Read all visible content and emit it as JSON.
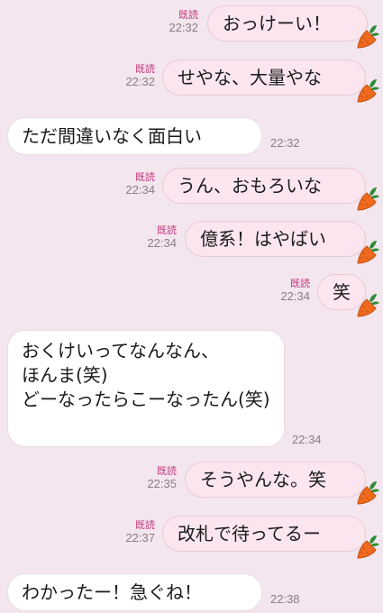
{
  "messages": [
    {
      "dir": "out",
      "text": "おっけーい！",
      "read": "既読",
      "time": "22:32"
    },
    {
      "dir": "out",
      "text": "せやな、大量やな",
      "read": "既読",
      "time": "22:32"
    },
    {
      "dir": "in",
      "text": "ただ間違いなく面白い",
      "time": "22:32"
    },
    {
      "dir": "out",
      "text": "うん、おもろいな",
      "read": "既読",
      "time": "22:34"
    },
    {
      "dir": "out",
      "text": "億系！はやばい",
      "read": "既読",
      "time": "22:34"
    },
    {
      "dir": "out",
      "text": "笑",
      "read": "既読",
      "time": "22:34"
    },
    {
      "dir": "in",
      "text": "おくけいってなんなん、\nほんま(笑)\nどーなったらこーなったん(笑)",
      "time": "22:34"
    },
    {
      "dir": "out",
      "text": "そうやんな。笑",
      "read": "既読",
      "time": "22:35"
    },
    {
      "dir": "out",
      "text": "改札で待ってるー",
      "read": "既読",
      "time": "22:37"
    },
    {
      "dir": "in",
      "text": "わかったー！急ぐね！",
      "time": "22:38"
    }
  ],
  "icons": {
    "sticker": "carrot-icon"
  },
  "colors": {
    "background": "#f4e6ef",
    "outgoing_bubble": "#fbe6ef",
    "incoming_bubble": "#ffffff",
    "read_label": "#c2387b",
    "timestamp": "#8a7c86",
    "carrot": "#ef6a1e",
    "carrot_leaf": "#2e8c3a"
  }
}
